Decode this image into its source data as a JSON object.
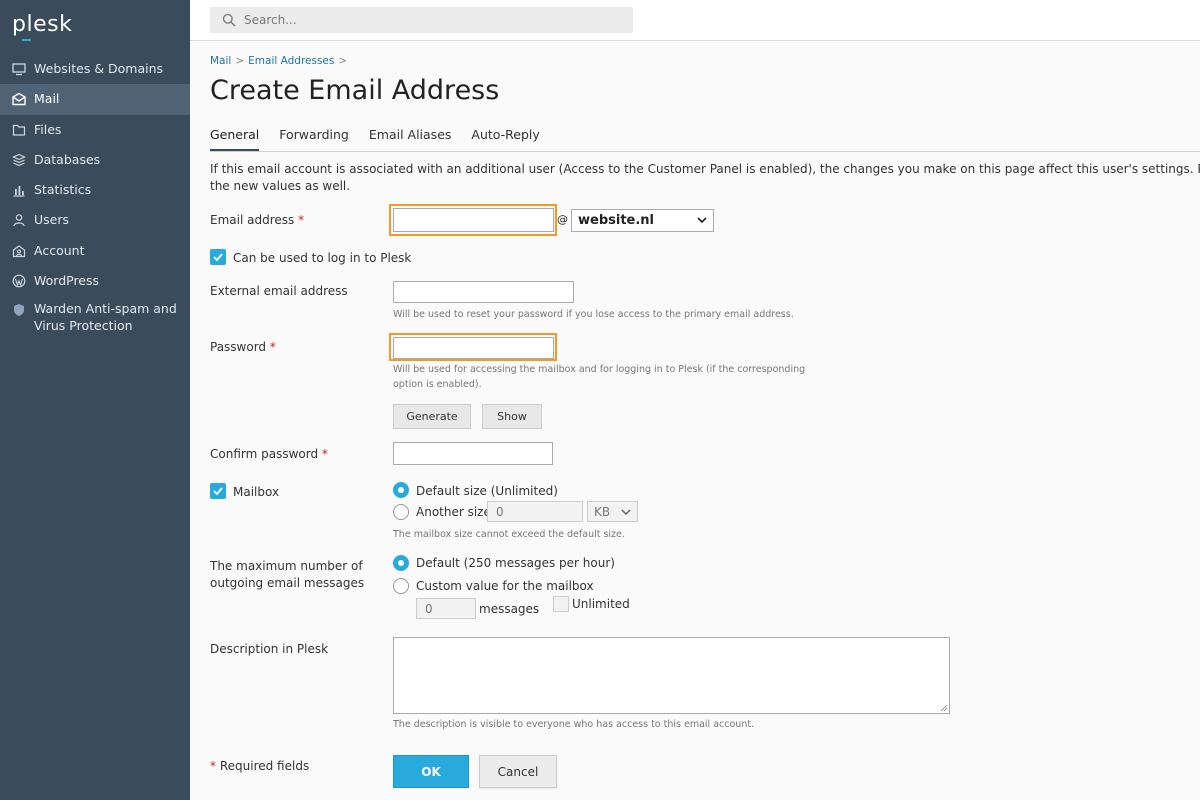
{
  "app": {
    "logo": "plesk"
  },
  "colors": {
    "sidebar": "#3a4b5c",
    "sidebar_active": "#4f6375",
    "accent": "#28aadc",
    "highlight": "#f09a2a",
    "required": "#d02020"
  },
  "sidebar": {
    "items": [
      {
        "label": "Websites & Domains",
        "icon": "monitor-icon"
      },
      {
        "label": "Mail",
        "icon": "mail-icon",
        "active": true
      },
      {
        "label": "Files",
        "icon": "folder-icon"
      },
      {
        "label": "Databases",
        "icon": "database-icon"
      },
      {
        "label": "Statistics",
        "icon": "bar-chart-icon"
      },
      {
        "label": "Users",
        "icon": "user-icon"
      },
      {
        "label": "Account",
        "icon": "account-icon"
      },
      {
        "label": "WordPress",
        "icon": "wordpress-icon"
      },
      {
        "label_line1": "Warden Anti-spam and",
        "label_line2": "Virus Protection",
        "icon": "shield-icon"
      }
    ]
  },
  "search": {
    "placeholder": "Search..."
  },
  "breadcrumb": {
    "items": [
      "Mail",
      "Email Addresses"
    ],
    "separator": ">"
  },
  "page": {
    "title": "Create Email Address"
  },
  "tabs": [
    "General",
    "Forwarding",
    "Email Aliases",
    "Auto-Reply"
  ],
  "info": {
    "line1": "If this email account is associated with an additional user (Access to the Customer Panel is enabled), the changes you make on this page affect this user's settings. Particularly, if you",
    "line2": "the new values as well."
  },
  "form": {
    "email_label": "Email address",
    "required_mark": "*",
    "at_sign": "@",
    "domain": "website.nl",
    "login_checkbox_label": "Can be used to log in to Plesk",
    "external_label": "External email address",
    "external_hint": "Will be used to reset your password if you lose access to the primary email address.",
    "password_label": "Password",
    "password_hint_line1": "Will be used for accessing the mailbox and for logging in to Plesk (if the corresponding",
    "password_hint_line2": "option is enabled).",
    "generate_label": "Generate",
    "show_label": "Show",
    "confirm_label": "Confirm password",
    "mailbox_label": "Mailbox",
    "default_size_label": "Default size (Unlimited)",
    "another_size_label": "Another size",
    "another_size_value": "0",
    "size_unit": "KB",
    "mailbox_hint": "The mailbox size cannot exceed the default size.",
    "max_label_line1": "The maximum number of",
    "max_label_line2": "outgoing email messages",
    "default_messages_label": "Default (250 messages per hour)",
    "custom_value_label": "Custom value for the mailbox",
    "messages_value": "0",
    "messages_label": "messages",
    "unlimited_label": "Unlimited",
    "description_label": "Description in Plesk",
    "description_hint": "The description is visible to everyone who has access to this email account.",
    "required_note": "Required fields",
    "ok_label": "OK",
    "cancel_label": "Cancel"
  }
}
